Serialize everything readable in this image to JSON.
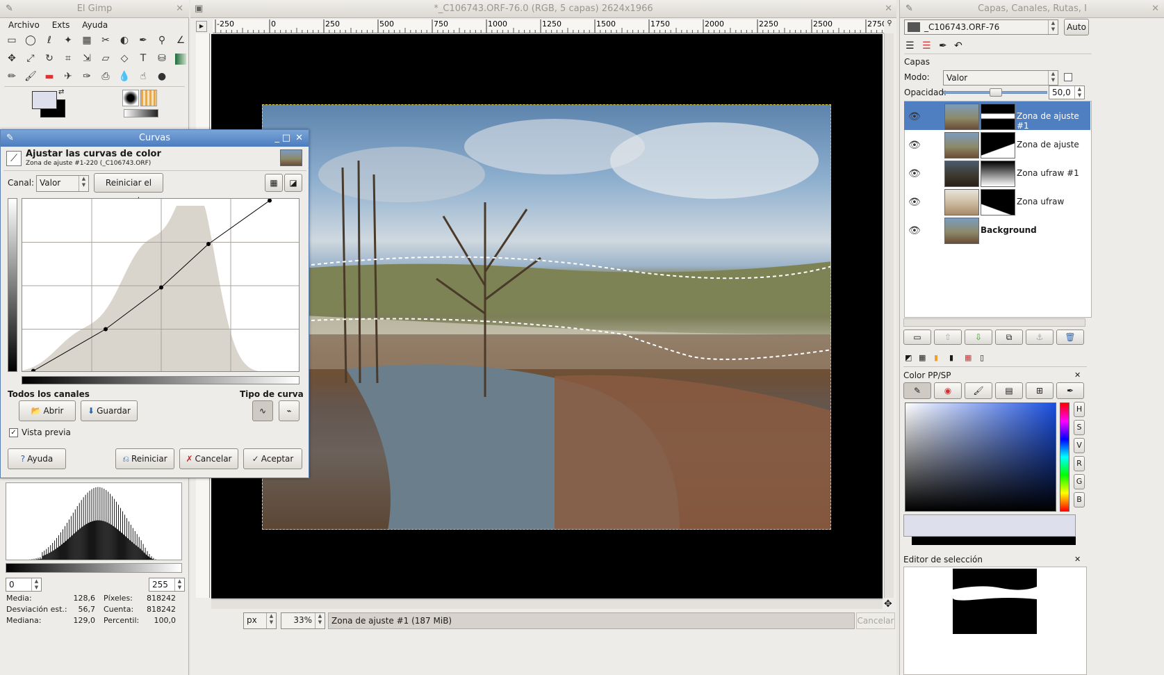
{
  "toolbox": {
    "title": "El Gimp",
    "menu": [
      "Archivo",
      "Exts",
      "Ayuda"
    ],
    "fg_color": "#dde0ec",
    "bg_color": "#000000"
  },
  "image_window": {
    "title": "*_C106743.ORF-76.0 (RGB, 5 capas) 2624x1966",
    "ruler_labels": [
      "-250",
      "0",
      "250",
      "500",
      "750",
      "1000",
      "1250",
      "1500",
      "1750",
      "2000",
      "2250",
      "2500",
      "2750"
    ],
    "unit": "px",
    "zoom": "33%",
    "status": "Zona de ajuste #1 (187 MiB)",
    "cancel_label": "Cancelar"
  },
  "curves_dialog": {
    "title": "Curvas",
    "heading": "Ajustar las curvas de color",
    "subheading": "Zona de ajuste #1-220 (_C106743.ORF)",
    "channel_label": "Canal:",
    "channel_value": "Valor",
    "reset_channel_label": "Reiniciar el canal",
    "all_channels_label": "Todos los canales",
    "curve_type_label": "Tipo de curva",
    "open_label": "Abrir",
    "save_label": "Guardar",
    "preview_label": "Vista previa",
    "preview_checked": true,
    "help_label": "Ayuda",
    "reset_label": "Reiniciar",
    "cancel_label": "Cancelar",
    "ok_label": "Aceptar"
  },
  "histogram": {
    "range_min": "0",
    "range_max": "255",
    "stats": [
      {
        "label": "Media:",
        "value": "128,6"
      },
      {
        "label": "Píxeles:",
        "value": "818242"
      },
      {
        "label": "Desviación est.:",
        "value": "56,7"
      },
      {
        "label": "Cuenta:",
        "value": "818242"
      },
      {
        "label": "Mediana:",
        "value": "129,0"
      },
      {
        "label": "Percentil:",
        "value": "100,0"
      }
    ]
  },
  "layers_dock": {
    "title": "Capas, Canales, Rutas, I",
    "image_name": "_C106743.ORF-76",
    "auto_label": "Auto",
    "section_title": "Capas",
    "mode_label": "Modo:",
    "mode_value": "Valor",
    "opacity_label": "Opacidad:",
    "opacity_value": "50,0",
    "opacity_fraction": 0.5,
    "layers": [
      {
        "name": "Zona de ajuste #1",
        "selected": true
      },
      {
        "name": "Zona de ajuste",
        "selected": false
      },
      {
        "name": "Zona ufraw #1",
        "selected": false
      },
      {
        "name": "Zona ufraw",
        "selected": false
      },
      {
        "name": "Background",
        "selected": false
      }
    ]
  },
  "color_dock": {
    "title": "Color PP/SP",
    "channels": [
      "H",
      "S",
      "V",
      "R",
      "G",
      "B"
    ]
  },
  "selection_dock": {
    "title": "Editor de selección"
  }
}
